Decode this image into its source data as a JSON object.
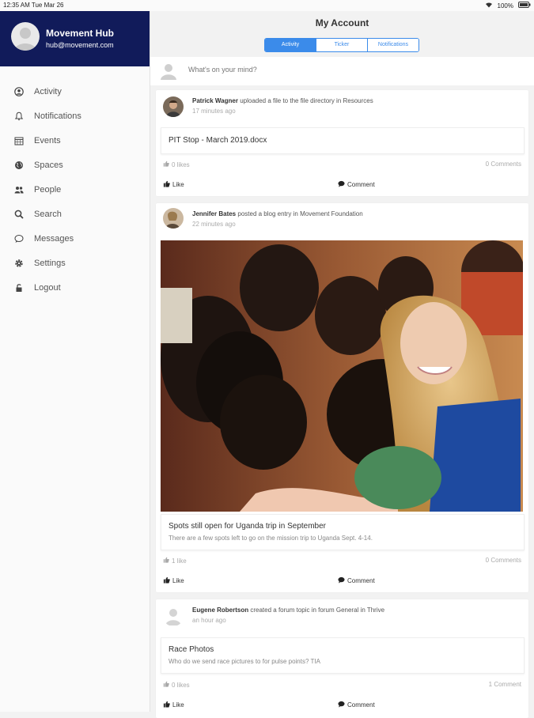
{
  "status_bar": {
    "time": "12:35 AM  Tue Mar 26",
    "battery": "100%"
  },
  "profile": {
    "name": "Movement Hub",
    "email": "hub@movement.com"
  },
  "nav": [
    {
      "label": "Activity",
      "icon": "user-circle-icon"
    },
    {
      "label": "Notifications",
      "icon": "bell-icon"
    },
    {
      "label": "Events",
      "icon": "calendar-icon"
    },
    {
      "label": "Spaces",
      "icon": "globe-icon"
    },
    {
      "label": "People",
      "icon": "people-icon"
    },
    {
      "label": "Search",
      "icon": "search-icon"
    },
    {
      "label": "Messages",
      "icon": "chat-icon"
    },
    {
      "label": "Settings",
      "icon": "gear-icon"
    },
    {
      "label": "Logout",
      "icon": "lock-icon"
    }
  ],
  "page": {
    "title": "My Account"
  },
  "tabs": [
    {
      "label": "Activity",
      "active": true
    },
    {
      "label": "Ticker",
      "active": false
    },
    {
      "label": "Notifications",
      "active": false
    }
  ],
  "composer": {
    "placeholder": "What's on your mind?"
  },
  "posts": [
    {
      "author": "Patrick Wagner",
      "action": "uploaded a file to the file directory in Resources",
      "time": "17 minutes ago",
      "attachment_title": "PIT Stop - March 2019.docx",
      "likes": "0 likes",
      "comments": "0 Comments",
      "like_label": "Like",
      "comment_label": "Comment"
    },
    {
      "author": "Jennifer Bates",
      "action": "posted a blog entry in Movement Foundation",
      "time": "22 minutes ago",
      "attachment_title": "Spots still open for Uganda trip in September",
      "attachment_body": "There are a few spots left to go on the mission trip to Uganda Sept. 4-14.",
      "likes": "1 like",
      "comments": "0 Comments",
      "like_label": "Like",
      "comment_label": "Comment"
    },
    {
      "author": "Eugene Robertson",
      "action": "created a forum topic in forum General in Thrive",
      "time": "an hour ago",
      "attachment_title": "Race Photos",
      "attachment_body": "Who do we send race pictures to for pulse points? TIA",
      "likes": "0 likes",
      "comments": "1 Comment",
      "like_label": "Like",
      "comment_label": "Comment"
    }
  ],
  "colors": {
    "accent": "#3b8bea",
    "profile_bg": "#111b5a"
  }
}
